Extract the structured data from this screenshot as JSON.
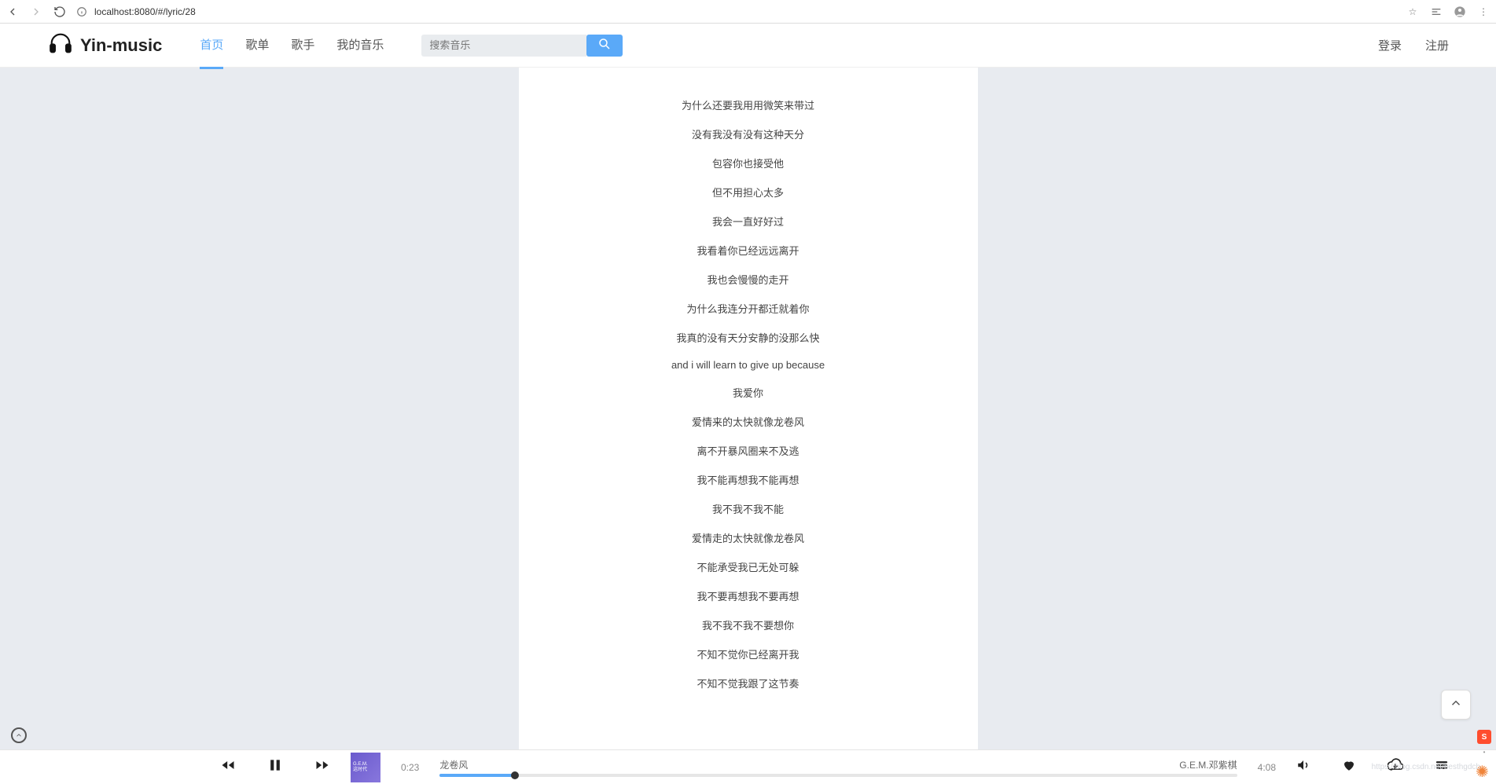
{
  "browser": {
    "url": "localhost:8080/#/lyric/28"
  },
  "brand": "Yin-music",
  "nav": {
    "home": "首页",
    "playlist": "歌单",
    "singer": "歌手",
    "my_music": "我的音乐"
  },
  "search": {
    "placeholder": "搜索音乐"
  },
  "auth": {
    "login": "登录",
    "register": "注册"
  },
  "lyrics": [
    "为什么还要我用用微笑来带过",
    "没有我没有没有这种天分",
    "包容你也接受他",
    "但不用担心太多",
    "我会一直好好过",
    "我看着你已经远远离开",
    "我也会慢慢的走开",
    "为什么我连分开都迁就着你",
    "我真的没有天分安静的没那么快",
    "and i will learn to give up because",
    "我爱你",
    "爱情来的太快就像龙卷风",
    "离不开暴风圈来不及逃",
    "我不能再想我不能再想",
    "我不我不我不能",
    "爱情走的太快就像龙卷风",
    "不能承受我已无处可躲",
    "我不要再想我不要再想",
    "我不我不我不要想你",
    "不知不觉你已经离开我",
    "不知不觉我跟了这节奏"
  ],
  "player": {
    "album_line1": "G.E.M.",
    "album_line2": "这时代",
    "current_time": "0:23",
    "title": "龙卷风",
    "artist": "G.E.M.邓紫棋",
    "duration": "4:08",
    "progress_percent": 9.4
  },
  "watermark": "https://blog.csdn.net/besthgdcb"
}
